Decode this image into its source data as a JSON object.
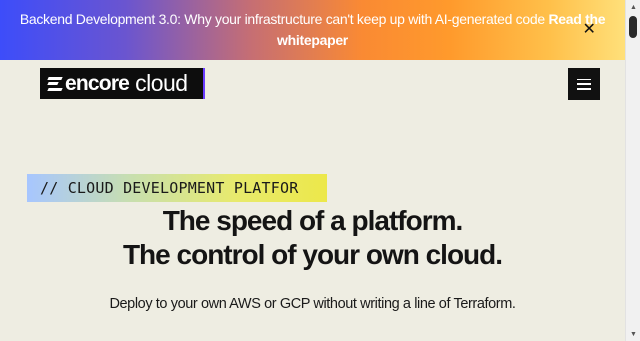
{
  "banner": {
    "text": "Backend Development 3.0: Why your infrastructure can't keep up with AI-generated code",
    "link_label": "Read the whitepaper",
    "close_glyph": "✕"
  },
  "header": {
    "logo_word_1": "encore",
    "logo_word_2": "cloud",
    "menu_icon": "hamburger-menu-icon"
  },
  "hero": {
    "tag": "// CLOUD DEVELOPMENT PLATFOR",
    "headline_line_1": "The speed of a platform.",
    "headline_line_2": "The control of your own cloud.",
    "subline": "Deploy to your own AWS or GCP without writing a line of Terraform."
  },
  "colors": {
    "page_background": "#eeede2",
    "banner_gradient_start": "#3d4dfa",
    "banner_gradient_end": "#ffe07a",
    "logo_background": "#0d0d0d",
    "tag_gradient_start": "#a7c6ff",
    "tag_gradient_end": "#ece84a"
  }
}
